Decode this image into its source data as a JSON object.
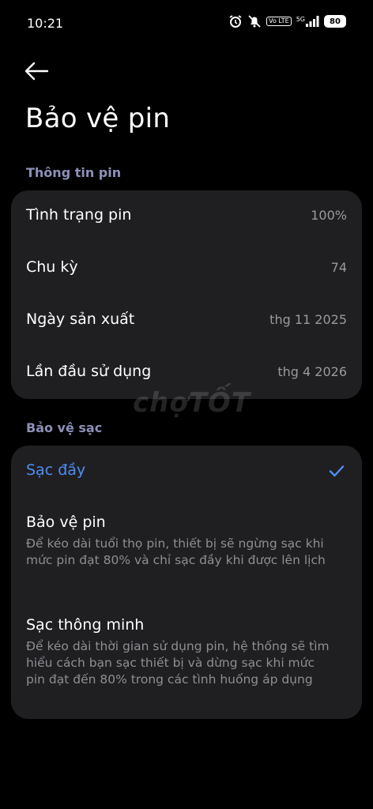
{
  "status_bar": {
    "time": "10:21",
    "volte_tag": "Vo LTE",
    "network": "5G",
    "battery": "80"
  },
  "page": {
    "title": "Bảo vệ pin"
  },
  "battery_info": {
    "header": "Thông tin pin",
    "rows": [
      {
        "label": "Tình trạng pin",
        "value": "100%"
      },
      {
        "label": "Chu kỳ",
        "value": "74"
      },
      {
        "label": "Ngày sản xuất",
        "value": "thg 11 2025"
      },
      {
        "label": "Lần đầu sử dụng",
        "value": "thg 4 2026"
      }
    ]
  },
  "charging_protection": {
    "header": "Bảo vệ sạc",
    "options": [
      {
        "title": "Sạc đầy",
        "selected": true
      },
      {
        "title": "Bảo vệ pin",
        "desc": "Để kéo dài tuổi thọ pin, thiết bị sẽ ngừng sạc khi mức pin đạt 80% và chỉ sạc đầy khi được lên lịch"
      },
      {
        "title": "Sạc thông minh",
        "desc": "Để kéo dài thời gian sử dụng pin, hệ thống sẽ tìm hiểu cách bạn sạc thiết bị và dừng sạc khi mức pin đạt đến 80% trong các tình huống áp dụng"
      }
    ]
  },
  "watermark": "chợTỐT",
  "colors": {
    "accent": "#4f8df5",
    "card": "#1f1f21",
    "section_header": "#8d90b8"
  }
}
